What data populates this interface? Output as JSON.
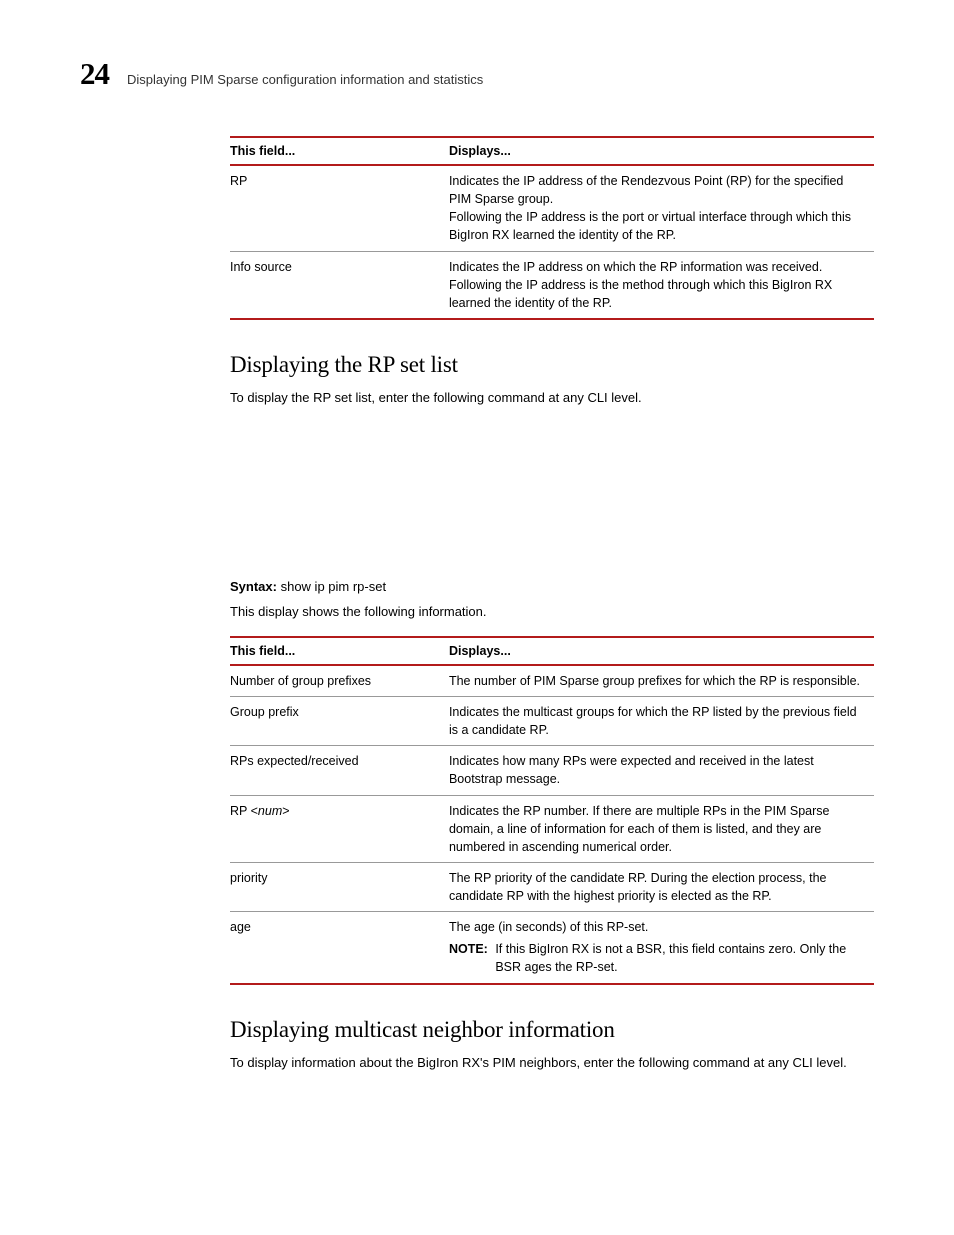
{
  "header": {
    "chapter_number": "24",
    "chapter_title": "Displaying PIM Sparse configuration information and statistics"
  },
  "table1": {
    "head_field": "This field...",
    "head_displays": "Displays...",
    "rows": [
      {
        "field": "RP",
        "p1": "Indicates the IP address of the Rendezvous Point (RP) for the specified PIM Sparse group.",
        "p2": "Following the IP address is the port or virtual interface through which this BigIron RX learned the identity of the RP."
      },
      {
        "field": "Info source",
        "p1": "Indicates the IP address on which the RP information was received.",
        "p2": "Following the IP address is the method through which this BigIron RX learned the identity of the RP."
      }
    ]
  },
  "section_rpset": {
    "heading": "Displaying the RP set list",
    "intro": "To display the RP set list, enter the following command at any CLI level.",
    "syntax_label": "Syntax:",
    "syntax_cmd": "show ip pim rp-set",
    "lead_in": "This display shows the following information."
  },
  "table2": {
    "head_field": "This field...",
    "head_displays": "Displays...",
    "rows": [
      {
        "field": "Number of group prefixes",
        "desc": "The number of PIM Sparse group prefixes for which the RP is responsible."
      },
      {
        "field": "Group prefix",
        "desc": "Indicates the multicast groups for which the RP listed by the previous field is a candidate RP."
      },
      {
        "field": "RPs expected/received",
        "desc": "Indicates how many RPs were expected and received in the latest Bootstrap message."
      },
      {
        "field_html": true,
        "field_prefix": "RP <",
        "field_mid": "num",
        "field_suffix": ">",
        "desc": "Indicates the RP number. If there are multiple RPs in the PIM Sparse domain, a line of information for each of them is listed, and they are numbered in ascending numerical order."
      },
      {
        "field": "priority",
        "desc": "The RP priority of the candidate RP. During the election process, the candidate RP with the highest priority is elected as the RP."
      },
      {
        "field": "age",
        "desc": "The age (in seconds) of this RP-set.",
        "note_label": "NOTE:",
        "note": "If this BigIron RX is not a BSR, this field contains zero. Only the BSR ages the RP-set."
      }
    ]
  },
  "section_neighbor": {
    "heading": "Displaying multicast neighbor information",
    "intro": "To display information about the BigIron RX's PIM neighbors, enter the following command at any CLI level."
  }
}
